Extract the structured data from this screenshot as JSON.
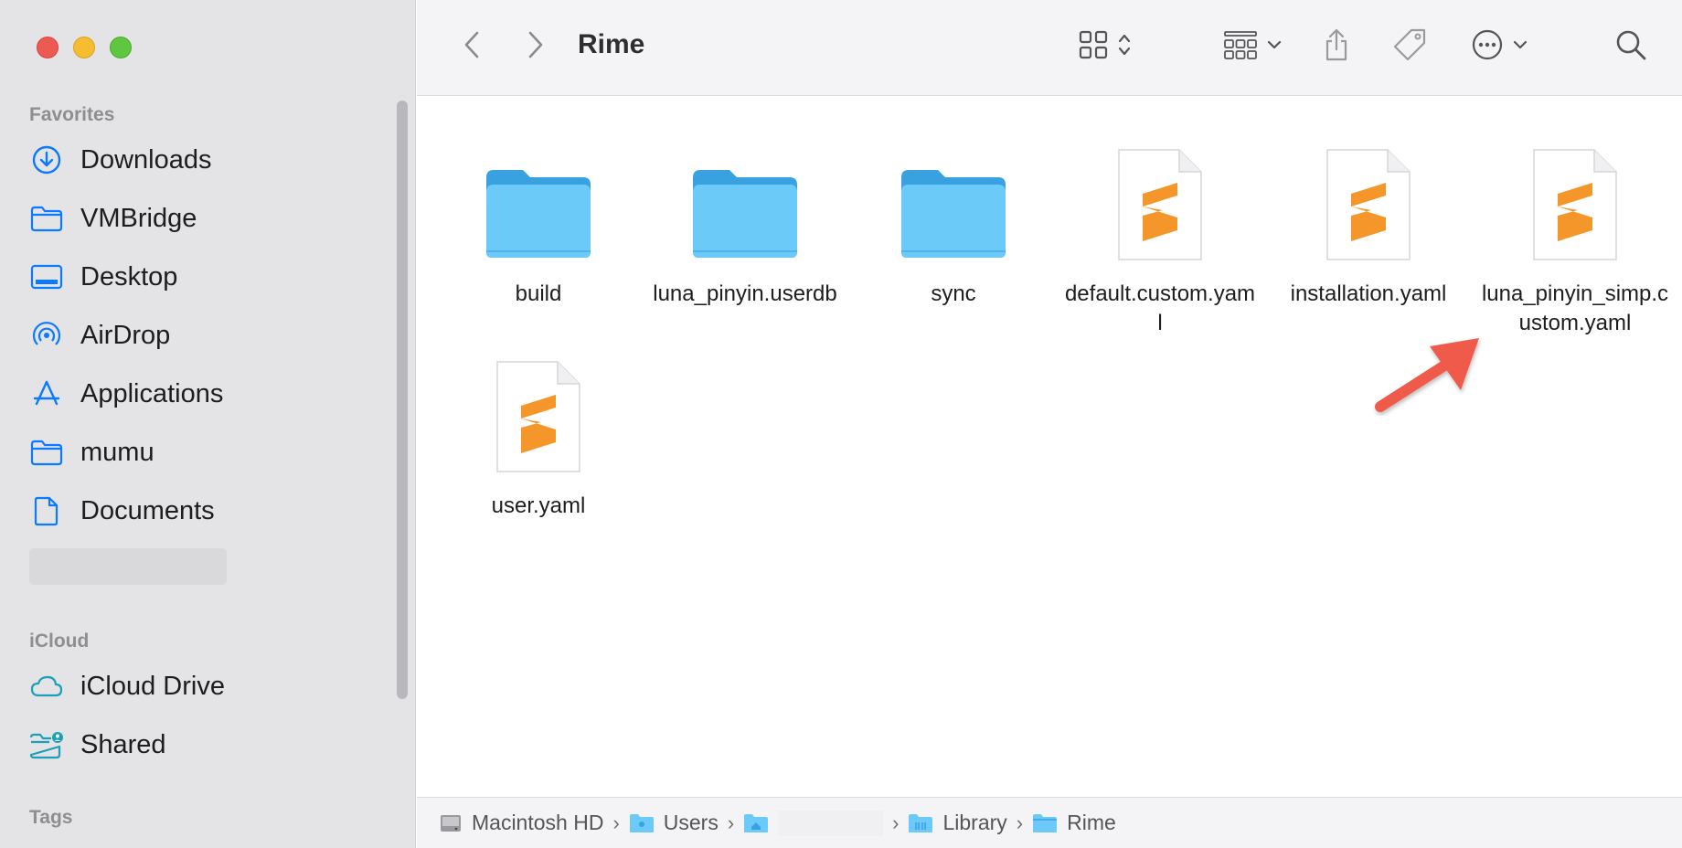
{
  "window": {
    "title": "Rime"
  },
  "sidebar": {
    "favorites_header": "Favorites",
    "favorites": [
      {
        "label": "Downloads",
        "icon": "download-circle-icon"
      },
      {
        "label": "VMBridge",
        "icon": "folder-icon"
      },
      {
        "label": "Desktop",
        "icon": "desktop-icon"
      },
      {
        "label": "AirDrop",
        "icon": "airdrop-icon"
      },
      {
        "label": "Applications",
        "icon": "applications-icon"
      },
      {
        "label": "mumu",
        "icon": "folder-icon"
      },
      {
        "label": "Documents",
        "icon": "document-icon"
      }
    ],
    "icloud_header": "iCloud",
    "icloud": [
      {
        "label": "iCloud Drive",
        "icon": "cloud-icon"
      },
      {
        "label": "Shared",
        "icon": "shared-folder-icon"
      }
    ],
    "tags_header": "Tags"
  },
  "files": [
    {
      "name": "build",
      "type": "folder"
    },
    {
      "name": "luna_pinyin.userdb",
      "type": "folder"
    },
    {
      "name": "sync",
      "type": "folder"
    },
    {
      "name": "default.custom.yaml",
      "type": "sublime-file"
    },
    {
      "name": "installation.yaml",
      "type": "sublime-file"
    },
    {
      "name": "luna_pinyin_simp.custom.yaml",
      "type": "sublime-file"
    },
    {
      "name": "user.yaml",
      "type": "sublime-file"
    }
  ],
  "pathbar": [
    {
      "label": "Macintosh HD",
      "icon": "hard-drive-icon"
    },
    {
      "label": "Users",
      "icon": "folder-icon"
    },
    {
      "label": "",
      "icon": "home-folder-icon"
    },
    {
      "label": "Library",
      "icon": "folder-icon"
    },
    {
      "label": "Rime",
      "icon": "folder-icon"
    }
  ],
  "colors": {
    "accent": "#0a7aff",
    "folder": "#62c0f5",
    "sublime": "#f5962a",
    "arrow": "#ef5a4c"
  }
}
